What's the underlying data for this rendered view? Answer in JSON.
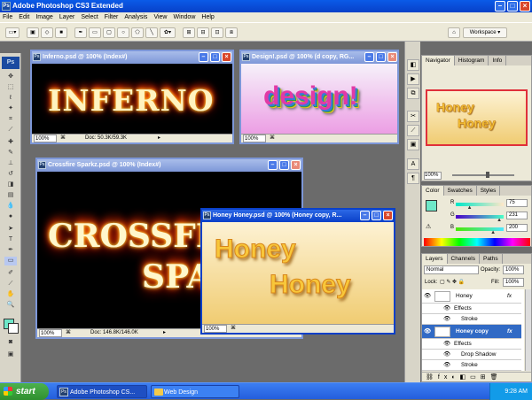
{
  "app": {
    "title": "Adobe Photoshop CS3 Extended",
    "icon_label": "Ps"
  },
  "menu": [
    "File",
    "Edit",
    "Image",
    "Layer",
    "Select",
    "Filter",
    "Analysis",
    "View",
    "Window",
    "Help"
  ],
  "options": {
    "workspace_label": "Workspace ▾"
  },
  "docs": [
    {
      "title": "Inferno.psd @ 100% (Index#)",
      "art": "INFERNO",
      "zoom": "100%",
      "info": "Doc: 50.3K/59.3K"
    },
    {
      "title": "Design!.psd @ 100% (d copy, RG...",
      "art": "design!",
      "zoom": "100%"
    },
    {
      "title": "Crossfire Sparkz.psd @ 100% (Index#)",
      "art1": "CROSSFIRE",
      "art2": "SPARKZ",
      "zoom": "100%",
      "info": "Doc: 146.8K/146.0K"
    },
    {
      "title": "Honey Honey.psd @ 100% (Honey copy, R...",
      "art1": "Honey",
      "art2": "Honey",
      "zoom": "100%"
    }
  ],
  "navigator": {
    "tabs": [
      "Navigator",
      "Histogram",
      "Info"
    ],
    "art1": "Honey",
    "art2": "Honey",
    "zoom": "100%"
  },
  "color": {
    "tabs": [
      "Color",
      "Swatches",
      "Styles"
    ],
    "r": "75",
    "g": "231",
    "b": "200",
    "r_label": "R",
    "g_label": "G",
    "b_label": "B",
    "r_level": 0.29,
    "g_level": 0.91,
    "b_level": 0.78,
    "accent": "#6ee7c8"
  },
  "layers": {
    "tabs": [
      "Layers",
      "Channels",
      "Paths"
    ],
    "blend": "Normal",
    "opacity_label": "Opacity:",
    "opacity": "100%",
    "lock_label": "Lock:",
    "fill_label": "Fill:",
    "fill": "100%",
    "rows": [
      "Honey",
      "Effects",
      "Stroke",
      "Honey copy",
      "Effects",
      "Drop Shadow",
      "Stroke"
    ]
  },
  "taskbar": {
    "start": "start",
    "item1": "Adobe Photoshop CS...",
    "item2": "Web Design",
    "time": "9:28 AM"
  }
}
